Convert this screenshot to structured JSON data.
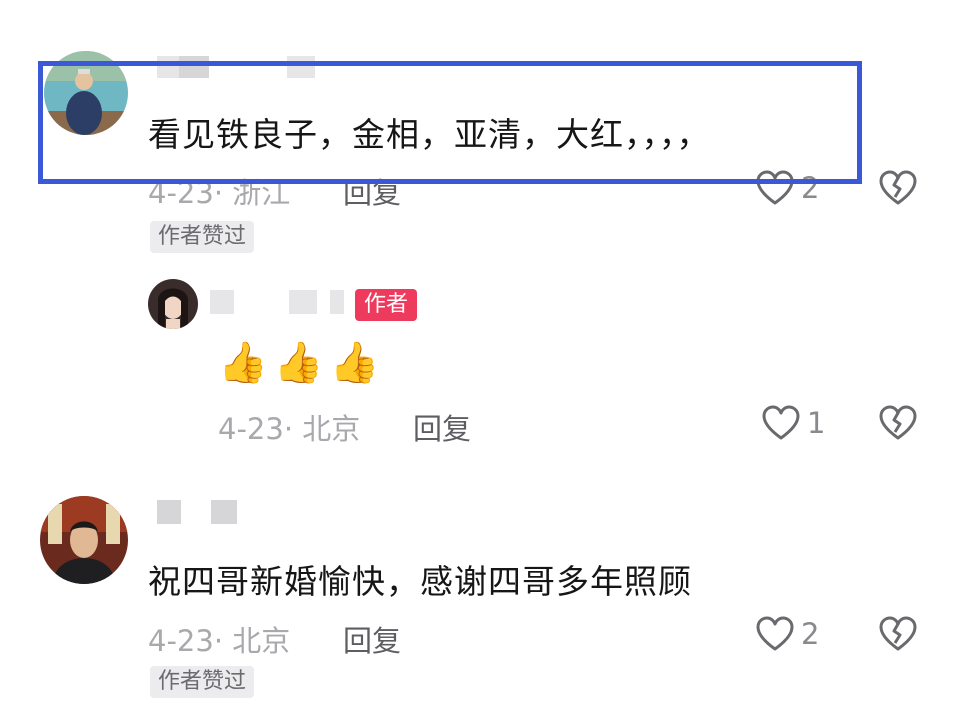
{
  "comments": [
    {
      "text": "看见铁良子，金相，亚清，大红，，，，",
      "meta": "4-23· 浙江",
      "reply_label": "回复",
      "likes": "2",
      "badge": "作者赞过",
      "reply": {
        "author_tag": "作者",
        "emoji": "👍👍👍",
        "meta": "4-23· 北京",
        "reply_label": "回复",
        "likes": "1"
      }
    },
    {
      "text": "祝四哥新婚愉快，感谢四哥多年照顾",
      "meta": "4-23· 北京",
      "reply_label": "回复",
      "likes": "2",
      "badge": "作者赞过"
    }
  ],
  "colors": {
    "highlight_border": "#3b59d6",
    "author_badge": "#ee3a5c",
    "text": "#161616",
    "meta": "#a9a9ad"
  }
}
